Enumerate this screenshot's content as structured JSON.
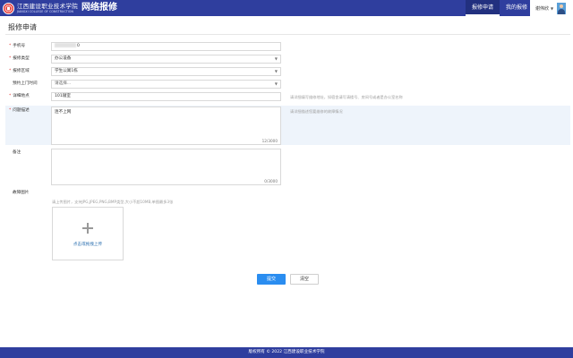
{
  "header": {
    "school_name_cn": "江西建设职业技术学院",
    "school_name_en": "JIANGXI COLLEGE OF CONSTRUCTION",
    "app_title": "网络报修",
    "nav": [
      {
        "label": "报修申请",
        "active": true
      },
      {
        "label": "我的报修",
        "active": false
      }
    ],
    "user_name": "谢伟欣",
    "brand_color": "#2f3e9e"
  },
  "page": {
    "title": "报修申请"
  },
  "form": {
    "phone": {
      "label": "手机号",
      "required": true,
      "value_suffix": "0"
    },
    "repair_type": {
      "label": "报修类型",
      "required": true,
      "value": "办公设备"
    },
    "repair_area": {
      "label": "报修区域",
      "required": true,
      "value": "学生公寓1栋"
    },
    "visit_time": {
      "label": "预约上门时间",
      "required": false,
      "placeholder": "请选择..."
    },
    "location": {
      "label": "详细地点",
      "required": true,
      "value": "101寝室",
      "hint": "请详细填写维修地址，如宿舍请写清楼号、房间号或者是办公室名称"
    },
    "description": {
      "label": "问题描述",
      "required": true,
      "value": "连不上网",
      "counter": "12/3000",
      "hint": "请详细描述您要维修的故障情况"
    },
    "remark": {
      "label": "备注",
      "required": false,
      "value": "",
      "counter": "0/3000"
    },
    "photos": {
      "label": "故障图片",
      "required": false,
      "hint": "请上传图片，支持JPG,JPEG,PNG,BMP类型,大小不超10MB,单图最多3张",
      "upload_label": "点击或拖拽上传"
    }
  },
  "buttons": {
    "submit": "提交",
    "clear": "清空",
    "accent_color": "#2a8df0"
  },
  "footer": {
    "text": "版权所有 © 2022 江西建设职业技术学院"
  }
}
